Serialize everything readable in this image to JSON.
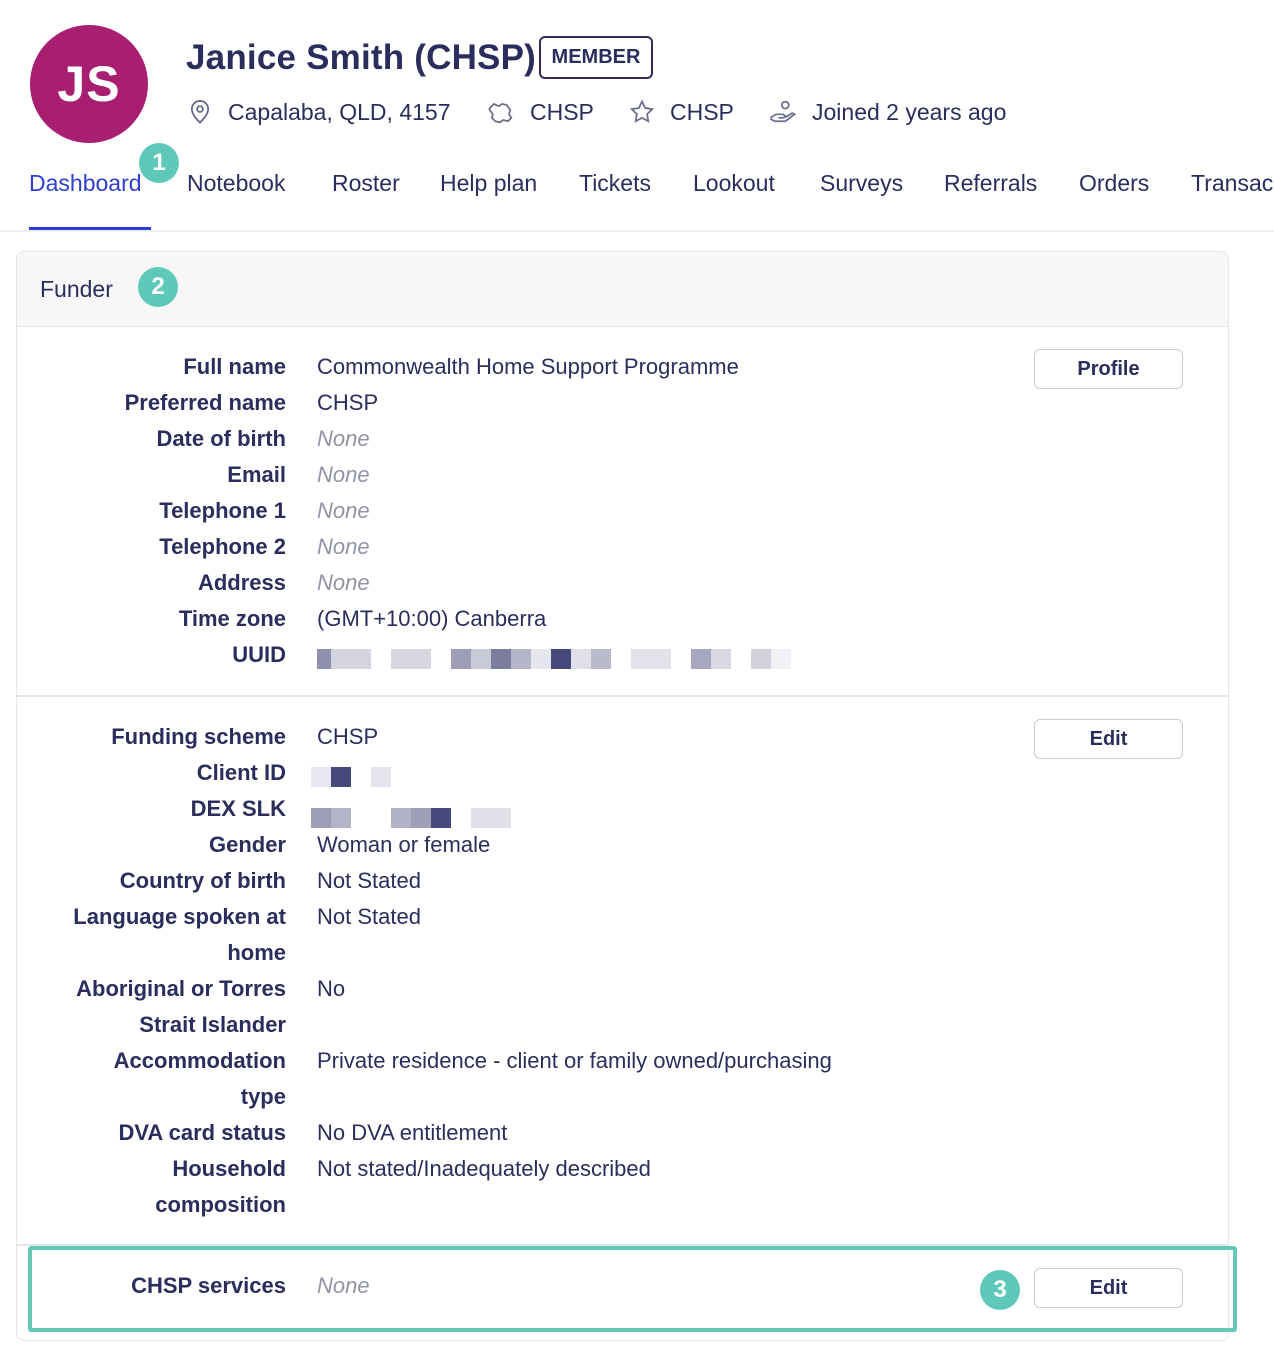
{
  "profile": {
    "initials": "JS",
    "name": "Janice Smith (CHSP)",
    "badge": "MEMBER",
    "location": "Capalaba, QLD, 4157",
    "region": "CHSP",
    "funder": "CHSP",
    "joined": "Joined 2 years ago",
    "avatar_color": "#a81f72"
  },
  "tabs": [
    "Dashboard",
    "Notebook",
    "Roster",
    "Help plan",
    "Tickets",
    "Lookout",
    "Surveys",
    "Referrals",
    "Orders",
    "Transac"
  ],
  "active_tab": "Dashboard",
  "callouts": [
    "1",
    "2",
    "3"
  ],
  "card": {
    "title": "Funder",
    "profile_button": "Profile",
    "edit_button": "Edit",
    "section1": [
      {
        "label": "Full name",
        "value": "Commonwealth Home Support Programme"
      },
      {
        "label": "Preferred name",
        "value": "CHSP"
      },
      {
        "label": "Date of birth",
        "value": "None"
      },
      {
        "label": "Email",
        "value": "None"
      },
      {
        "label": "Telephone 1",
        "value": "None"
      },
      {
        "label": "Telephone 2",
        "value": "None"
      },
      {
        "label": "Address",
        "value": "None"
      },
      {
        "label": "Time zone",
        "value": "(GMT+10:00) Canberra"
      },
      {
        "label": "UUID",
        "value": ""
      }
    ],
    "section2": {
      "funding_scheme_label": "Funding scheme",
      "funding_scheme": "CHSP",
      "client_id_label": "Client ID",
      "dex_slk_label": "DEX SLK",
      "gender_label": "Gender",
      "gender": "Woman or female",
      "country_label": "Country of birth",
      "country": "Not Stated",
      "language_label_1": "Language spoken at",
      "language_label_2": "home",
      "language": "Not Stated",
      "aboriginal_label_1": "Aboriginal or Torres",
      "aboriginal_label_2": "Strait Islander",
      "aboriginal": "No",
      "accommodation_label_1": "Accommodation",
      "accommodation_label_2": "type",
      "accommodation": "Private residence - client or family owned/purchasing",
      "dva_label": "DVA card status",
      "dva": "No DVA entitlement",
      "household_label_1": "Household",
      "household_label_2": "composition",
      "household": "Not stated/Inadequately described"
    },
    "section3": {
      "label": "CHSP services",
      "value": "None"
    }
  },
  "colors": {
    "text": "#2b2d5c",
    "accent": "#2c3fd0",
    "callout": "#5ec9b9",
    "muted": "#9194a8"
  }
}
